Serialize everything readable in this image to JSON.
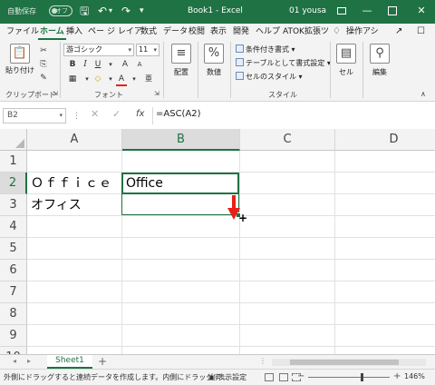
{
  "titlebar": {
    "autosave_label": "自動保存",
    "autosave_state": "オフ",
    "title": "Book1 - Excel",
    "user": "01 yousa",
    "icons": [
      "save-icon",
      "undo-icon",
      "redo-icon",
      "customize-icon",
      "ribbon-display-icon",
      "minimize-icon",
      "restore-icon",
      "close-icon"
    ]
  },
  "tabs": [
    "ファイル",
    "ホーム",
    "挿入",
    "ペー",
    "ジ レイア",
    "数式",
    "データ",
    "校閲",
    "表示",
    "開発",
    "ヘルプ",
    "ATOK拡張ツ",
    "操作アシ"
  ],
  "active_tab": "ホーム",
  "ribbon": {
    "clipboard": {
      "paste_label": "貼り付け",
      "group_label": "クリップボード"
    },
    "font": {
      "font_name": "游ゴシック",
      "font_size": "11",
      "bold": "B",
      "italic": "I",
      "underline": "U",
      "grow": "A",
      "shrink": "A",
      "font_color": "A",
      "group_label": "フォント"
    },
    "alignment": {
      "label": "配置"
    },
    "number": {
      "label": "数値",
      "icon_text": "%"
    },
    "styles": {
      "conditional": "条件付き書式",
      "table": "テーブルとして書式設定",
      "cell_styles": "セルのスタイル",
      "group_label": "スタイル"
    },
    "cells": {
      "label": "セル"
    },
    "editing": {
      "label": "編集"
    }
  },
  "formula_bar": {
    "name_box": "B2",
    "fx": "fx",
    "formula": "=ASC(A2)"
  },
  "grid": {
    "columns": [
      "A",
      "B",
      "C",
      "D"
    ],
    "rows": [
      "1",
      "2",
      "3",
      "4",
      "5",
      "6",
      "7",
      "8",
      "9",
      "10"
    ],
    "selected_column": "B",
    "selected_row": "2",
    "cells": {
      "A2": "Ｏｆｆｉｃｅ",
      "B2": "Office",
      "A3": "オフィス"
    }
  },
  "sheets": {
    "tabs": [
      "Sheet1"
    ],
    "active": "Sheet1",
    "add": "+"
  },
  "statusbar": {
    "message": "外側にドラッグすると連続データを作成します。内側にドラッグす…",
    "display_settings": "表示設定",
    "zoom": "146%",
    "zoom_minus": "−",
    "zoom_plus": "+"
  },
  "colors": {
    "excel_green": "#1f7244",
    "arrow_red": "#e8201a"
  }
}
